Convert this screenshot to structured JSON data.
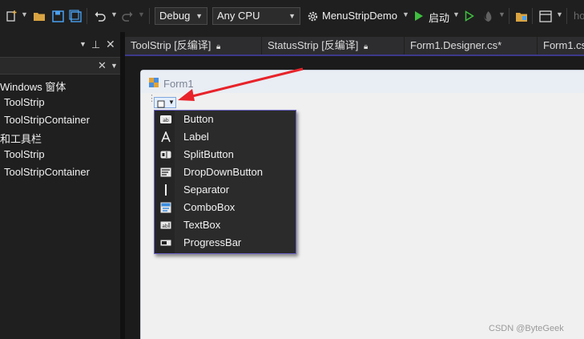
{
  "toolbar": {
    "config_combo": "Debug",
    "platform_combo": "Any CPU",
    "startup_project": "MenuStripDemo",
    "start_label": "启动",
    "overflow_text": "ho"
  },
  "left_panel": {
    "items": [
      {
        "label": "Windows 窗体"
      },
      {
        "label": "ToolStrip"
      },
      {
        "label": "ToolStripContainer"
      },
      {
        "label": "和工具栏"
      },
      {
        "label": "ToolStrip"
      },
      {
        "label": "ToolStripContainer"
      }
    ]
  },
  "tabs": [
    {
      "label": "ToolStrip [反编译]"
    },
    {
      "label": "StatusStrip [反编译]"
    },
    {
      "label": "Form1.Designer.cs*"
    },
    {
      "label": "Form1.cs"
    }
  ],
  "form": {
    "title": "Form1"
  },
  "menu": {
    "items": [
      {
        "label": "Button",
        "icon": "button-icon"
      },
      {
        "label": "Label",
        "icon": "label-icon"
      },
      {
        "label": "SplitButton",
        "icon": "split-button-icon"
      },
      {
        "label": "DropDownButton",
        "icon": "dropdown-button-icon"
      },
      {
        "label": "Separator",
        "icon": "separator-icon"
      },
      {
        "label": "ComboBox",
        "icon": "combobox-icon"
      },
      {
        "label": "TextBox",
        "icon": "textbox-icon"
      },
      {
        "label": "ProgressBar",
        "icon": "progressbar-icon"
      }
    ]
  },
  "watermark": "CSDN @ByteGeek",
  "colors": {
    "accent": "#6b62c8",
    "arrow": "#e8232a",
    "run_green": "#3fbf3f"
  }
}
